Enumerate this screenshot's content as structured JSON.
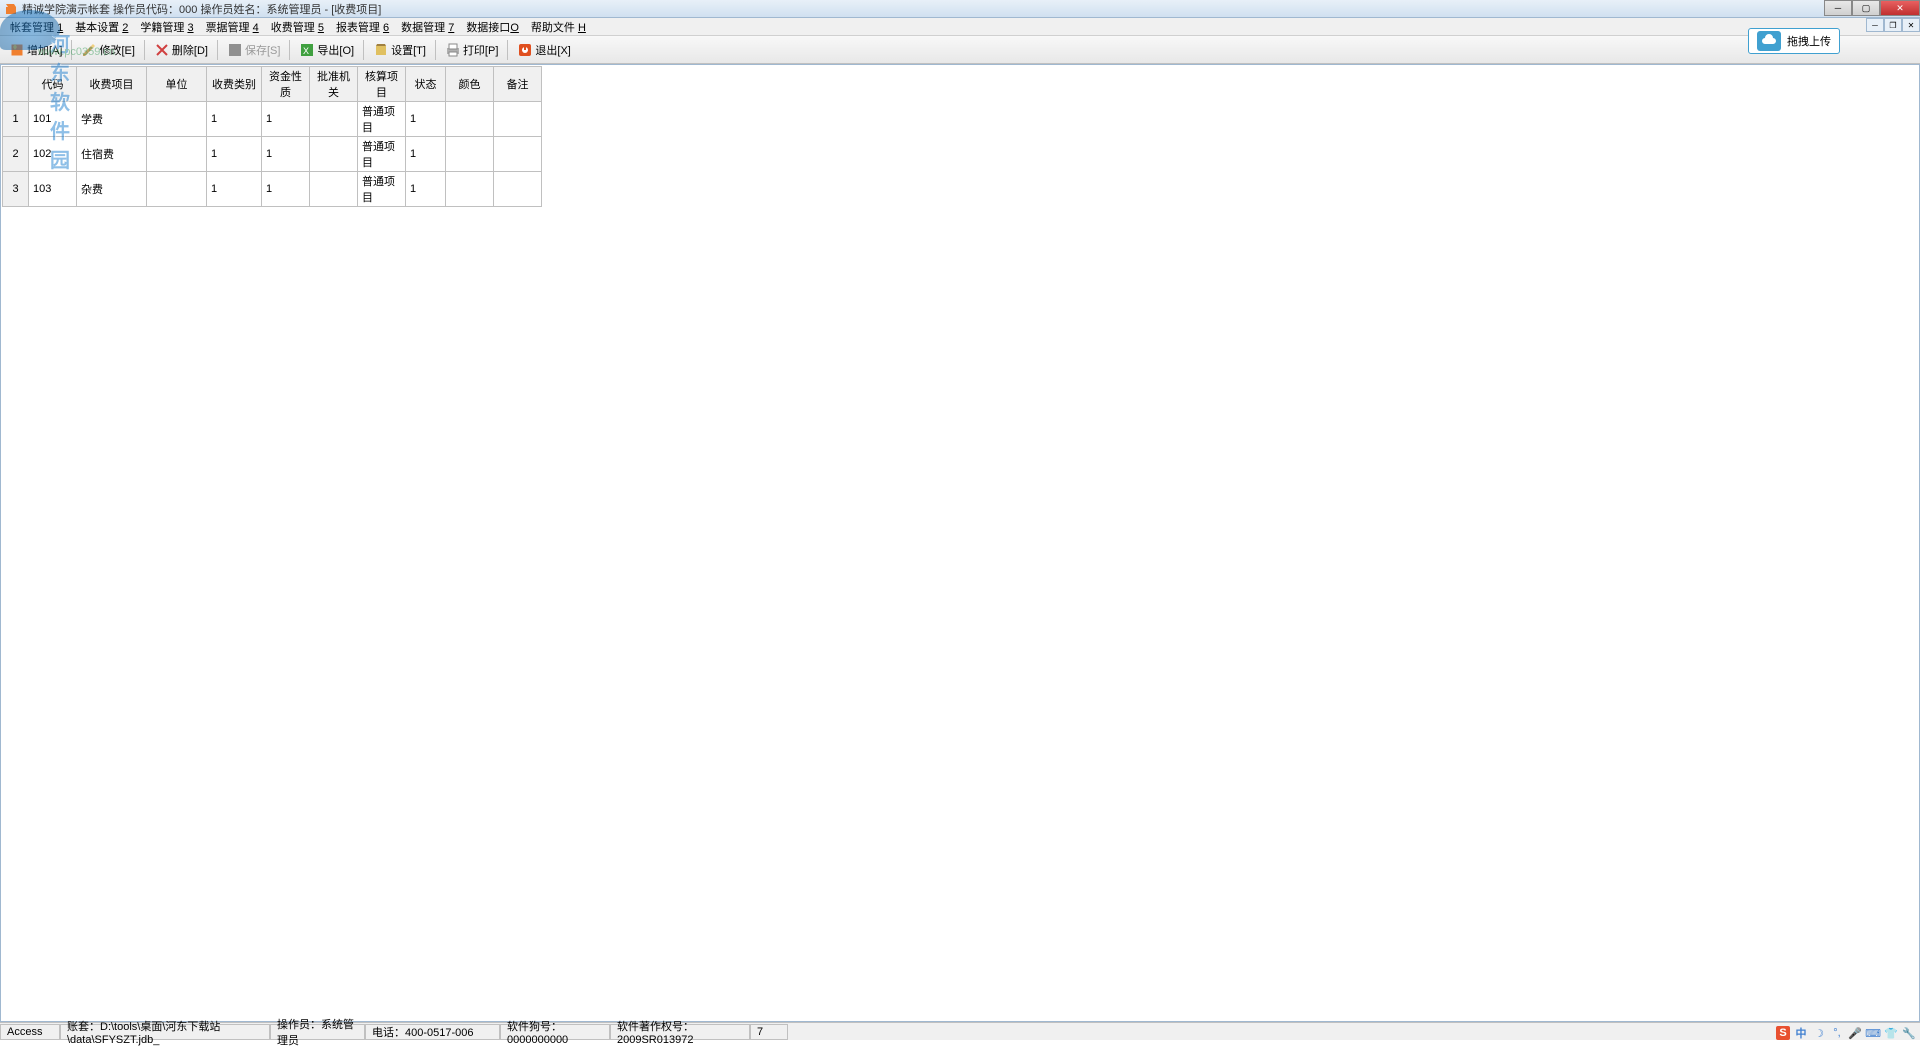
{
  "titlebar": {
    "text": "精诚学院演示帐套  操作员代码：000  操作员姓名：系统管理员 - [收费项目]"
  },
  "menubar": {
    "items": [
      {
        "label": "帐套管理",
        "key": "1"
      },
      {
        "label": "基本设置",
        "key": "2"
      },
      {
        "label": "学籍管理",
        "key": "3"
      },
      {
        "label": "票据管理",
        "key": "4"
      },
      {
        "label": "收费管理",
        "key": "5"
      },
      {
        "label": "报表管理",
        "key": "6"
      },
      {
        "label": "数据管理",
        "key": "7"
      },
      {
        "label": "数据接口",
        "key": "O"
      },
      {
        "label": "帮助文件",
        "key": "H"
      }
    ]
  },
  "toolbar": {
    "add": "增加[A]",
    "edit": "修改[E]",
    "delete": "删除[D]",
    "save": "保存[S]",
    "export": "导出[O]",
    "settings": "设置[T]",
    "print": "打印[P]",
    "exit": "退出[X]"
  },
  "upload": {
    "label": "拖拽上传"
  },
  "watermark": {
    "text": "河东软件园",
    "url": "www.pc0359.cn"
  },
  "table": {
    "headers": [
      "",
      "代码",
      "收费项目",
      "单位",
      "收费类别",
      "资金性质",
      "批准机关",
      "核算项目",
      "状态",
      "颜色",
      "备注"
    ],
    "rows": [
      {
        "num": "1",
        "code": "101",
        "name": "学费",
        "unit": "",
        "type": "1",
        "fund": "1",
        "approve": "",
        "account": "普通项目",
        "status": "1",
        "color": "",
        "remark": ""
      },
      {
        "num": "2",
        "code": "102",
        "name": "住宿费",
        "unit": "",
        "type": "1",
        "fund": "1",
        "approve": "",
        "account": "普通项目",
        "status": "1",
        "color": "",
        "remark": ""
      },
      {
        "num": "3",
        "code": "103",
        "name": "杂费",
        "unit": "",
        "type": "1",
        "fund": "1",
        "approve": "",
        "account": "普通项目",
        "status": "1",
        "color": "",
        "remark": ""
      }
    ]
  },
  "statusbar": {
    "db": "Access",
    "account_path": "账套：D:\\tools\\桌面\\河东下载站\\data\\SFYSZT.jdb_",
    "operator": "操作员：系统管理员",
    "phone": "电话：400-0517-006",
    "dongle": "软件狗号：0000000000",
    "copyright": "软件著作权号：2009SR013972",
    "extra": "7"
  },
  "tray": {
    "ime": "中"
  }
}
